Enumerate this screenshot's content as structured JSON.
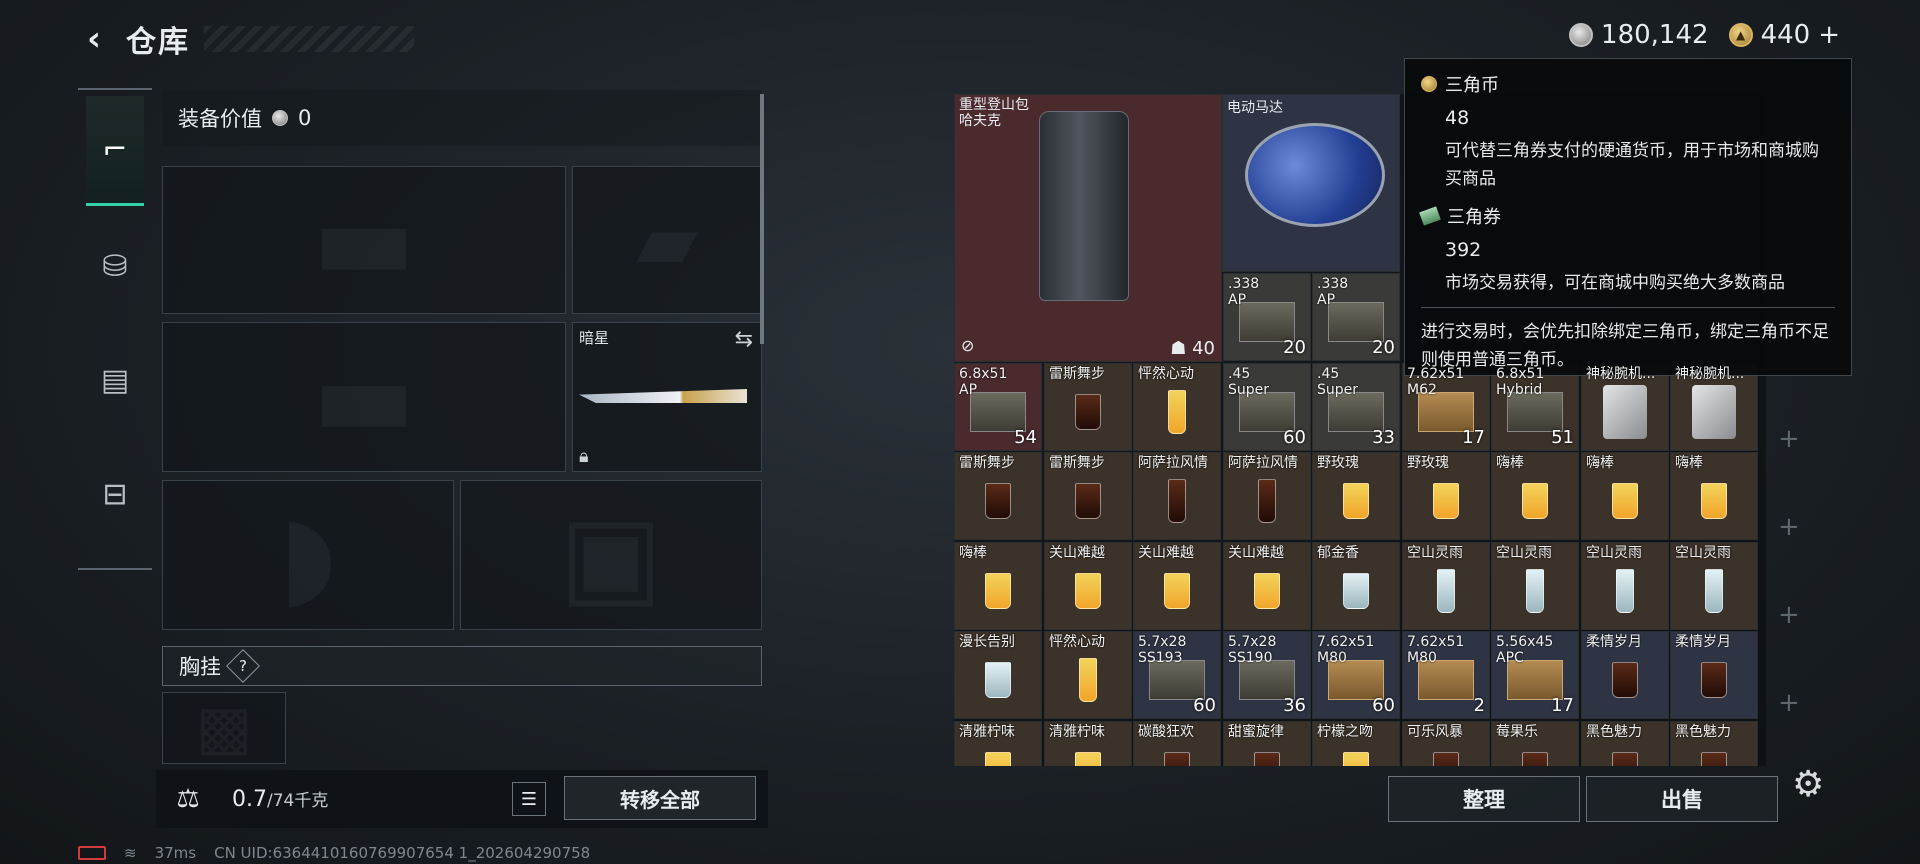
{
  "header": {
    "back_icon": "chevron-left-icon",
    "title": "仓库"
  },
  "currency": {
    "silver_amount": "180,142",
    "gold_amount": "440",
    "plus_label": "+"
  },
  "rail": {
    "tabs": [
      "gun-icon",
      "backpack-icon",
      "clipboard-icon",
      "toolbox-icon"
    ],
    "active_index": 0
  },
  "left": {
    "equip_value_label": "装备价值",
    "equip_value": "0",
    "secondary_slot_label": "暗星",
    "chest_rig_label": "胸挂",
    "help_mark": "?",
    "weight_current": "0.7",
    "weight_max": "/74千克",
    "transfer_all": "转移全部"
  },
  "status": {
    "ping": "37ms",
    "uid": "CN UID:6364410160769907654 1_202604290758"
  },
  "grid": {
    "backpack": {
      "name": "重型登山包\n哈夫克",
      "count": "40"
    },
    "motor": {
      "name": "电动马达"
    },
    "cells": [
      {
        "name": ".338\nAP",
        "count": "20",
        "style": "gray",
        "art": "ammo",
        "col": 3,
        "row": 2
      },
      {
        "name": ".338\nAP",
        "count": "20",
        "style": "gray",
        "art": "ammo",
        "col": 4,
        "row": 2
      },
      {
        "name": "6.8x51\nAP",
        "count": "54",
        "style": "red",
        "art": "ammo",
        "col": 0,
        "row": 3
      },
      {
        "name": "雷斯舞步",
        "count": "",
        "style": "",
        "art": "drink dark",
        "col": 1,
        "row": 3
      },
      {
        "name": "怦然心动",
        "count": "",
        "style": "",
        "art": "drink tall",
        "col": 2,
        "row": 3
      },
      {
        "name": ".45\nSuper",
        "count": "60",
        "style": "gray",
        "art": "ammo",
        "col": 3,
        "row": 3
      },
      {
        "name": ".45\nSuper",
        "count": "33",
        "style": "gray",
        "art": "ammo",
        "col": 4,
        "row": 3
      },
      {
        "name": "7.62x51\nM62",
        "count": "17",
        "style": "",
        "art": "ammo crate",
        "col": 5,
        "row": 3
      },
      {
        "name": "6.8x51\nHybrid",
        "count": "51",
        "style": "",
        "art": "ammo",
        "col": 6,
        "row": 3
      },
      {
        "name": "神秘腕机...",
        "count": "",
        "style": "",
        "art": "strap",
        "col": 7,
        "row": 3
      },
      {
        "name": "神秘腕机...",
        "count": "",
        "style": "",
        "art": "strap",
        "col": 8,
        "row": 3
      },
      {
        "name": "雷斯舞步",
        "count": "",
        "style": "",
        "art": "drink dark",
        "col": 0,
        "row": 4
      },
      {
        "name": "雷斯舞步",
        "count": "",
        "style": "",
        "art": "drink dark",
        "col": 1,
        "row": 4
      },
      {
        "name": "阿萨拉风情",
        "count": "",
        "style": "",
        "art": "drink dark tall",
        "col": 2,
        "row": 4
      },
      {
        "name": "阿萨拉风情",
        "count": "",
        "style": "",
        "art": "drink dark tall",
        "col": 3,
        "row": 4
      },
      {
        "name": "野玫瑰",
        "count": "",
        "style": "",
        "art": "drink",
        "col": 4,
        "row": 4
      },
      {
        "name": "野玫瑰",
        "count": "",
        "style": "",
        "art": "drink",
        "col": 5,
        "row": 4
      },
      {
        "name": "嗨棒",
        "count": "",
        "style": "",
        "art": "drink",
        "col": 6,
        "row": 4
      },
      {
        "name": "嗨棒",
        "count": "",
        "style": "",
        "art": "drink",
        "col": 7,
        "row": 4
      },
      {
        "name": "嗨棒",
        "count": "",
        "style": "",
        "art": "drink",
        "col": 8,
        "row": 4
      },
      {
        "name": "嗨棒",
        "count": "",
        "style": "",
        "art": "drink",
        "col": 0,
        "row": 5
      },
      {
        "name": "关山难越",
        "count": "",
        "style": "",
        "art": "drink",
        "col": 1,
        "row": 5
      },
      {
        "name": "关山难越",
        "count": "",
        "style": "",
        "art": "drink",
        "col": 2,
        "row": 5
      },
      {
        "name": "关山难越",
        "count": "",
        "style": "",
        "art": "drink",
        "col": 3,
        "row": 5
      },
      {
        "name": "郁金香",
        "count": "",
        "style": "",
        "art": "drink clear",
        "col": 4,
        "row": 5
      },
      {
        "name": "空山灵雨",
        "count": "",
        "style": "",
        "art": "drink clear tall",
        "col": 5,
        "row": 5
      },
      {
        "name": "空山灵雨",
        "count": "",
        "style": "",
        "art": "drink clear tall",
        "col": 6,
        "row": 5
      },
      {
        "name": "空山灵雨",
        "count": "",
        "style": "",
        "art": "drink clear tall",
        "col": 7,
        "row": 5
      },
      {
        "name": "空山灵雨",
        "count": "",
        "style": "",
        "art": "drink clear tall",
        "col": 8,
        "row": 5
      },
      {
        "name": "漫长告别",
        "count": "",
        "style": "",
        "art": "drink clear",
        "col": 0,
        "row": 6
      },
      {
        "name": "怦然心动",
        "count": "",
        "style": "",
        "art": "drink tall",
        "col": 1,
        "row": 6
      },
      {
        "name": "5.7x28\nSS193",
        "count": "60",
        "style": "blue",
        "art": "ammo",
        "col": 2,
        "row": 6
      },
      {
        "name": "5.7x28\nSS190",
        "count": "36",
        "style": "blue",
        "art": "ammo",
        "col": 3,
        "row": 6
      },
      {
        "name": "7.62x51\nM80",
        "count": "60",
        "style": "blue",
        "art": "ammo crate",
        "col": 4,
        "row": 6
      },
      {
        "name": "7.62x51\nM80",
        "count": "2",
        "style": "blue",
        "art": "ammo crate",
        "col": 5,
        "row": 6
      },
      {
        "name": "5.56x45\nAPC",
        "count": "17",
        "style": "blue",
        "art": "ammo crate",
        "col": 6,
        "row": 6
      },
      {
        "name": "柔情岁月",
        "count": "",
        "style": "blue",
        "art": "drink dark",
        "col": 7,
        "row": 6
      },
      {
        "name": "柔情岁月",
        "count": "",
        "style": "blue",
        "art": "drink dark",
        "col": 8,
        "row": 6
      },
      {
        "name": "清雅柠味",
        "count": "",
        "style": "",
        "art": "drink",
        "col": 0,
        "row": 7
      },
      {
        "name": "清雅柠味",
        "count": "",
        "style": "",
        "art": "drink",
        "col": 1,
        "row": 7
      },
      {
        "name": "碳酸狂欢",
        "count": "",
        "style": "",
        "art": "drink dark",
        "col": 2,
        "row": 7
      },
      {
        "name": "甜蜜旋律",
        "count": "",
        "style": "",
        "art": "drink dark",
        "col": 3,
        "row": 7
      },
      {
        "name": "柠檬之吻",
        "count": "",
        "style": "",
        "art": "drink",
        "col": 4,
        "row": 7
      },
      {
        "name": "可乐风暴",
        "count": "",
        "style": "",
        "art": "drink dark",
        "col": 5,
        "row": 7
      },
      {
        "name": "莓果乐",
        "count": "",
        "style": "",
        "art": "drink dark",
        "col": 6,
        "row": 7
      },
      {
        "name": "黑色魅力",
        "count": "",
        "style": "",
        "art": "drink dark",
        "col": 7,
        "row": 7
      },
      {
        "name": "黑色魅力",
        "count": "",
        "style": "",
        "art": "drink dark",
        "col": 8,
        "row": 7
      }
    ]
  },
  "tooltip": {
    "coin_title": "三角币",
    "coin_amount": "48",
    "coin_desc": "可代替三角券支付的硬通货币，用于市场和商城购买商品",
    "ticket_title": "三角券",
    "ticket_amount": "392",
    "ticket_desc": "市场交易获得，可在商城中购买绝大多数商品",
    "note": "进行交易时，会优先扣除绑定三角币，绑定三角币不足则使用普通三角币。"
  },
  "actions": {
    "sort_label": "整理",
    "sell_label": "出售"
  }
}
